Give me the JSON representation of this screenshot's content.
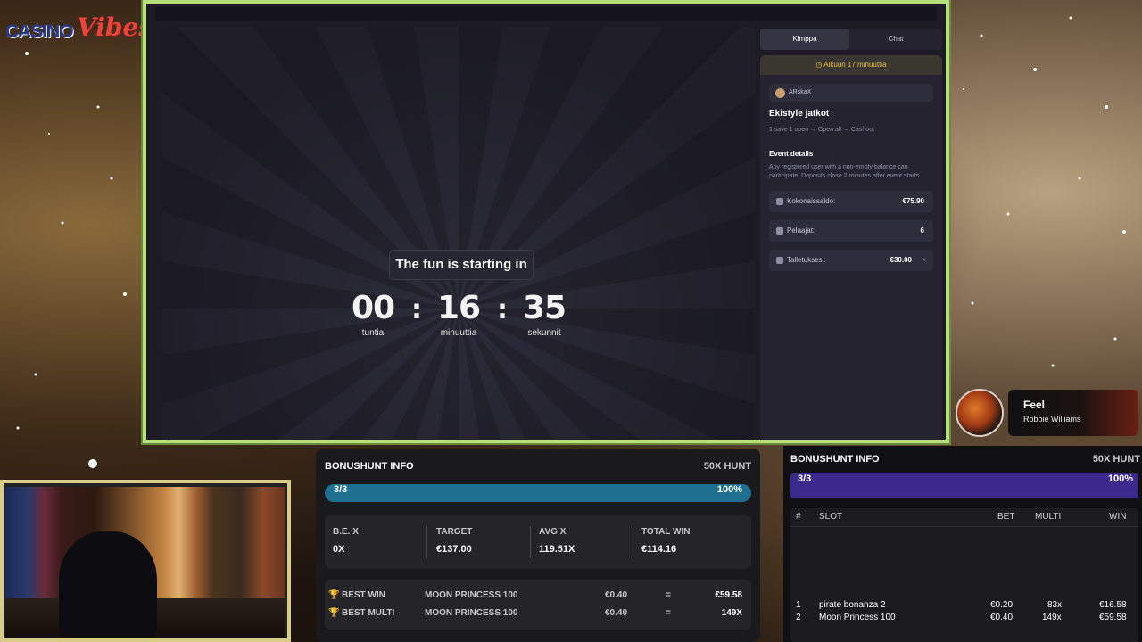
{
  "logo": {
    "part1": "CASINO",
    "part2": "Vibes"
  },
  "countdown": {
    "title": "The fun is starting in",
    "hours": "00",
    "hours_label": "tuntia",
    "minutes": "16",
    "minutes_label": "minuuttia",
    "seconds": "35",
    "seconds_label": "sekunnit",
    "separator": ":"
  },
  "side": {
    "tabs": [
      "Kimppa",
      "Chat"
    ],
    "banner": "Alkuun 17 minuuttia",
    "host": "ARskaX",
    "event_title": "Ekistyle jatkot",
    "event_sub": "1 save 1 open → Open all → Cashout",
    "details_title": "Event details",
    "details_text": "Any registered user with a non-empty balance can participate. Deposits close 2 minutes after event starts.",
    "rows": [
      {
        "label": "Kokonaissaldo:",
        "value": "€75.90",
        "icon": "wallet-icon"
      },
      {
        "label": "Pelaajat:",
        "value": "6",
        "icon": "users-icon"
      },
      {
        "label": "Talletuksesi:",
        "value": "€30.00",
        "icon": "deposit-icon",
        "close": "×"
      }
    ]
  },
  "now_playing": {
    "title": "Feel",
    "artist": "Robbie Williams"
  },
  "bonushunt_center": {
    "title": "BONUSHUNT INFO",
    "mode": "50X HUNT",
    "progress_label": "3/3",
    "progress_pct": "100%",
    "stats": [
      {
        "label": "B.E. X",
        "value": "0X"
      },
      {
        "label": "TARGET",
        "value": "€137.00"
      },
      {
        "label": "AVG X",
        "value": "119.51X"
      },
      {
        "label": "TOTAL WIN",
        "value": "€114.16"
      }
    ],
    "best": [
      {
        "label": "BEST WIN",
        "slot": "MOON PRINCESS 100",
        "bet": "€0.40",
        "eq": "=",
        "result": "€59.58"
      },
      {
        "label": "BEST MULTI",
        "slot": "MOON PRINCESS 100",
        "bet": "€0.40",
        "eq": "=",
        "result": "149X"
      }
    ]
  },
  "bonushunt_right": {
    "title": "BONUSHUNT INFO",
    "mode": "50X HUNT",
    "progress_label": "3/3",
    "progress_pct": "100%",
    "headers": {
      "num": "#",
      "slot": "SLOT",
      "bet": "BET",
      "multi": "MULTI",
      "win": "WIN"
    },
    "rows": [
      {
        "num": "1",
        "slot": "pirate bonanza 2",
        "bet": "€0.20",
        "multi": "83x",
        "win": "€16.58"
      },
      {
        "num": "2",
        "slot": "Moon Princess 100",
        "bet": "€0.40",
        "multi": "149x",
        "win": "€59.58"
      }
    ]
  },
  "colors": {
    "frame": "#b8e07a",
    "hunt_bar": "#1f7090",
    "hunt_bar_right": "#3b2a8c",
    "banner_text": "#f0c040"
  }
}
